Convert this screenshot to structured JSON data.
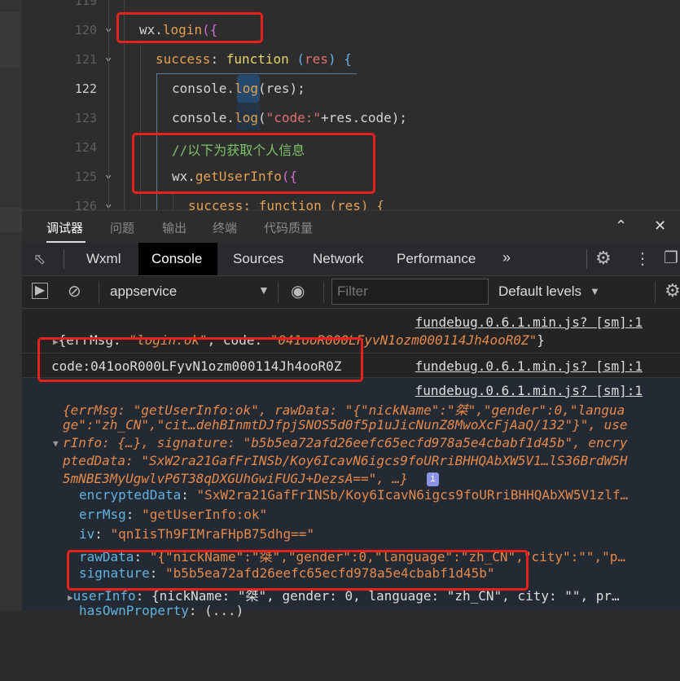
{
  "editor": {
    "lines": [
      {
        "num": "119",
        "fold": false
      },
      {
        "num": "120",
        "fold": true
      },
      {
        "num": "121",
        "fold": true
      },
      {
        "num": "122",
        "fold": false
      },
      {
        "num": "123",
        "fold": false
      },
      {
        "num": "124",
        "fold": false
      },
      {
        "num": "125",
        "fold": true
      },
      {
        "num": "126",
        "fold": true
      }
    ],
    "code": {
      "l120_obj": "wx.",
      "l120_fn": "login",
      "l120_p": "({",
      "l121_key": "success",
      "l121_colon": ": ",
      "l121_kw": "function",
      "l121_rest": " (",
      "l121_arg": "res",
      "l121_end": ") {",
      "l122_a": "console.",
      "l122_fn": "log",
      "l122_b": "(res);",
      "l123_a": "console.",
      "l123_fn": "log",
      "l123_b": "(",
      "l123_str": "\"code:\"",
      "l123_c": "+res.code);",
      "l124_comment": "//以下为获取个人信息",
      "l125_obj": "wx.",
      "l125_fn": "getUserInfo",
      "l125_p": "({",
      "l126": "success: function (res) {"
    }
  },
  "panel_tabs": [
    "调试器",
    "问题",
    "输出",
    "终端",
    "代码质量"
  ],
  "devtools_tabs": [
    "Wxml",
    "Console",
    "Sources",
    "Network",
    "Performance"
  ],
  "active_devtools_tab": "Console",
  "toolbar": {
    "context": "appservice",
    "filter_placeholder": "Filter",
    "levels": "Default levels"
  },
  "console": {
    "source_link": "fundebug.0.6.1.min.js? [sm]:1",
    "entry1": {
      "open": "{errMsg: ",
      "errMsg": "\"login:ok\"",
      "mid": ", code: ",
      "code": "\"041ooR000LFyvN1ozm000114Jh4ooR0Z\"",
      "close": "}"
    },
    "entry2": "code:041ooR000LFyvN1ozm000114Jh4ooR0Z",
    "entry3": {
      "summary": [
        "{errMsg: \"getUserInfo:ok\", rawData: \"{\"nickName\":\"桀\",\"gender\":0,\"langua",
        "ge\":\"zh_CN\",\"cit…dehBInmtDJfpjSNOS5d0f5p1uJicNunZ8MwoXcFjAaQ/132\"}\", use",
        "rInfo: {…}, signature: \"b5b5ea72afd26eefc65ecfd978a5e4cbabf1d45b\", encry",
        "ptedData: \"SxW2ra21GafFrINSb/Koy6IcavN6igcs9foURriBHHQAbXW5V1…lS36BrdW5H",
        "5mNBE3MyUgwlvP6T38qDXGUhGwiFUGJ+DezsA==\", …}"
      ],
      "props": [
        {
          "key": "encryptedData",
          "value": "\"SxW2ra21GafFrINSb/Koy6IcavN6igcs9foURriBHHQAbXW5V1zlf…"
        },
        {
          "key": "errMsg",
          "value": "\"getUserInfo:ok\""
        },
        {
          "key": "iv",
          "value": "\"qnIisTh9FIMraFHpB75dhg==\""
        },
        {
          "key": "rawData",
          "value": "\"{\"nickName\":\"桀\",\"gender\":0,\"language\":\"zh_CN\",\"city\":\"\",\"p…"
        },
        {
          "key": "signature",
          "value": "\"b5b5ea72afd26eefc65ecfd978a5e4cbabf1d45b\""
        },
        {
          "key": "userInfo",
          "value": "{nickName: \"桀\", gender: 0, language: \"zh_CN\", city: \"\", pr…"
        },
        {
          "key": "hasOwnProperty",
          "value": "(...)"
        }
      ]
    }
  },
  "colors": {
    "highlight_box": "#e8211c",
    "string": "#e5894a",
    "property": "#5fb3e0",
    "comment": "#7ec36a"
  }
}
